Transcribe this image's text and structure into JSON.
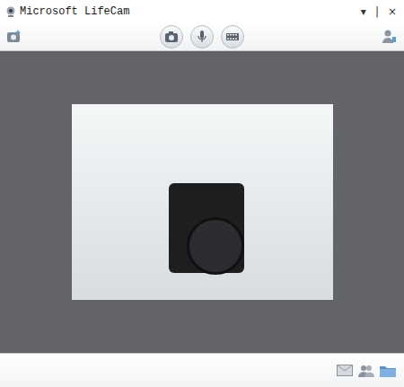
{
  "window": {
    "title": "Microsoft LifeCam",
    "controls": [
      "▾",
      "|",
      "×"
    ]
  }
}
